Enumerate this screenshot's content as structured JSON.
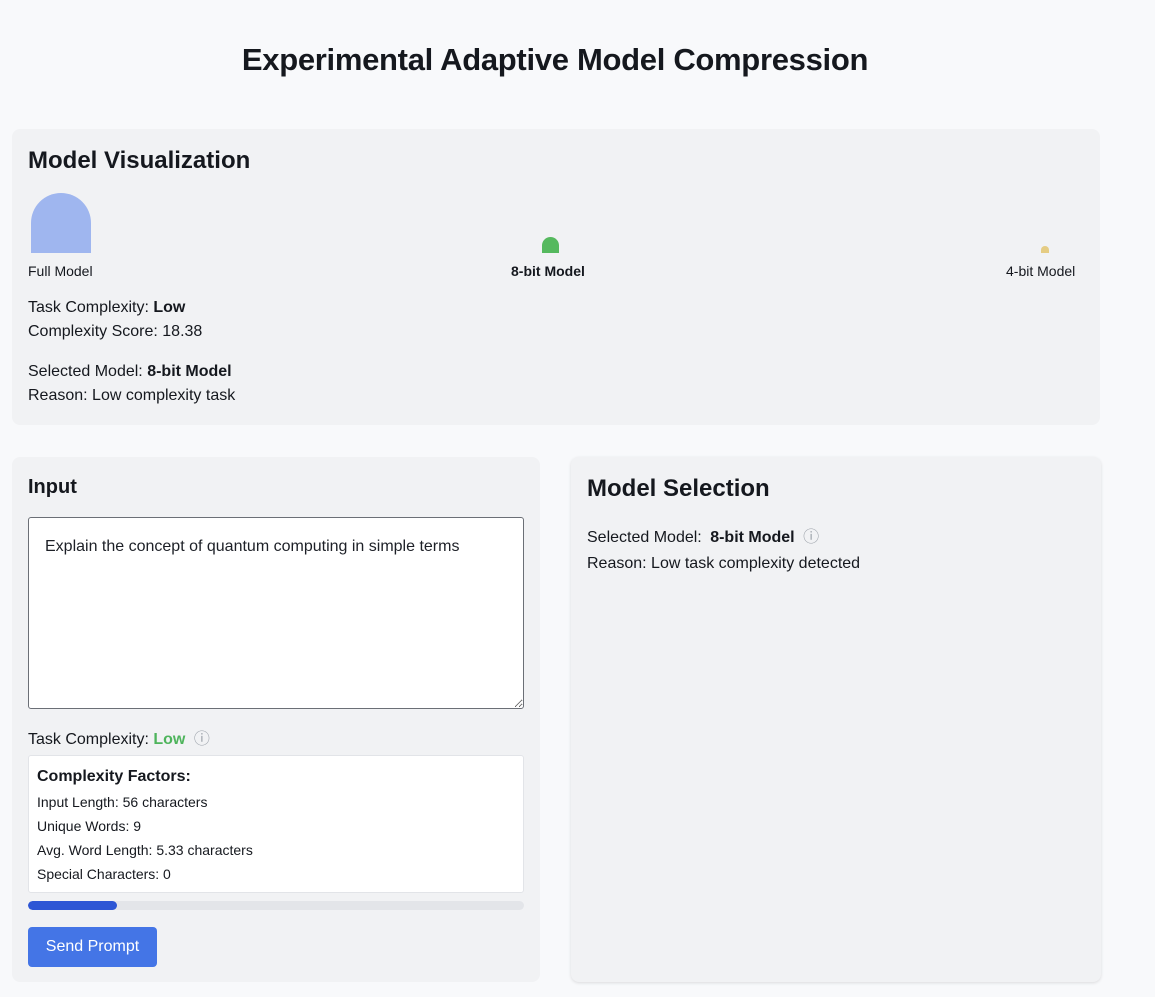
{
  "page": {
    "title": "Experimental Adaptive Model Compression"
  },
  "visualization": {
    "heading": "Model Visualization",
    "models": [
      {
        "label": "Full Model",
        "color": "#9fb6ef",
        "selected": false
      },
      {
        "label": "8-bit Model",
        "color": "#55b95e",
        "selected": true
      },
      {
        "label": "4-bit Model",
        "color": "#e5cc83",
        "selected": false
      }
    ],
    "task_complexity_label": "Task Complexity:",
    "task_complexity_value": "Low",
    "complexity_score_label": "Complexity Score:",
    "complexity_score_value": "18.38",
    "selected_model_label": "Selected Model:",
    "selected_model_value": "8-bit Model",
    "reason_label": "Reason:",
    "reason_value": "Low complexity task"
  },
  "input": {
    "heading": "Input",
    "prompt_value": "Explain the concept of quantum computing in simple terms",
    "task_complexity_label": "Task Complexity:",
    "task_complexity_value": "Low",
    "task_complexity_color": "#4eb45c",
    "info_icon": "ⓘ",
    "factors": {
      "title": "Complexity Factors:",
      "rows": [
        "Input Length: 56 characters",
        "Unique Words: 9",
        "Avg. Word Length: 5.33 characters",
        "Special Characters: 0"
      ]
    },
    "progress_fraction": 0.18,
    "send_label": "Send Prompt",
    "accent_color": "#4475e6"
  },
  "selection": {
    "heading": "Model Selection",
    "selected_model_label": "Selected Model:",
    "selected_model_value": "8-bit Model",
    "info_icon": "ⓘ",
    "reason_label": "Reason:",
    "reason_level": "Low",
    "reason_rest": "task complexity detected"
  }
}
